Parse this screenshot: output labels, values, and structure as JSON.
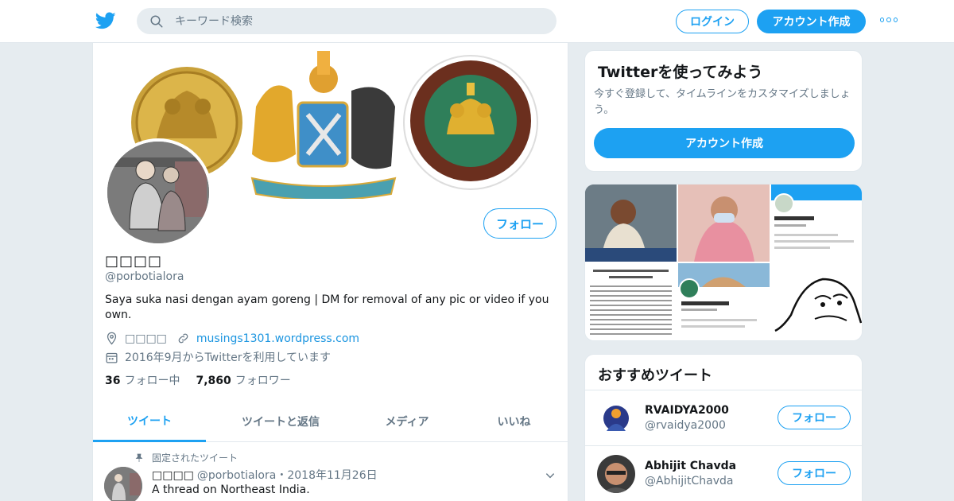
{
  "header": {
    "logo_icon": "twitter-bird-icon",
    "search_placeholder": "キーワード検索",
    "login_label": "ログイン",
    "signup_label": "アカウント作成",
    "more_icon": "more-dots-icon",
    "accent_color": "#1da1f2"
  },
  "profile": {
    "name": "□□□□",
    "handle": "@porbotialora",
    "follow_label": "フォロー",
    "bio": "Saya suka nasi dengan ayam goreng | DM for removal of any pic or video if you own.",
    "location": "□□□□",
    "website": "musings1301.wordpress.com",
    "joined": "2016年9月からTwitterを利用しています",
    "following_count": "36",
    "following_label": "フォロー中",
    "followers_count": "7,860",
    "followers_label": "フォロワー"
  },
  "tabs": [
    {
      "label": "ツイート"
    },
    {
      "label": "ツイートと返信"
    },
    {
      "label": "メディア"
    },
    {
      "label": "いいね"
    }
  ],
  "pinned_tweet": {
    "pinned_label": "固定されたツイート",
    "author_name": "□□□□",
    "author_handle": "@porbotialora",
    "date": "・2018年11月26日",
    "text": "A thread on Northeast India."
  },
  "signup_card": {
    "title": "Twitterを使ってみよう",
    "description": "今すぐ登録して、タイムラインをカスタマイズしましょう。",
    "button_label": "アカウント作成"
  },
  "recommended": {
    "title": "おすすめツイート",
    "follow_label": "フォロー",
    "users": [
      {
        "name": "RVAIDYA2000",
        "handle": "@rvaidya2000"
      },
      {
        "name": "Abhijit Chavda",
        "handle": "@AbhijitChavda"
      }
    ]
  }
}
